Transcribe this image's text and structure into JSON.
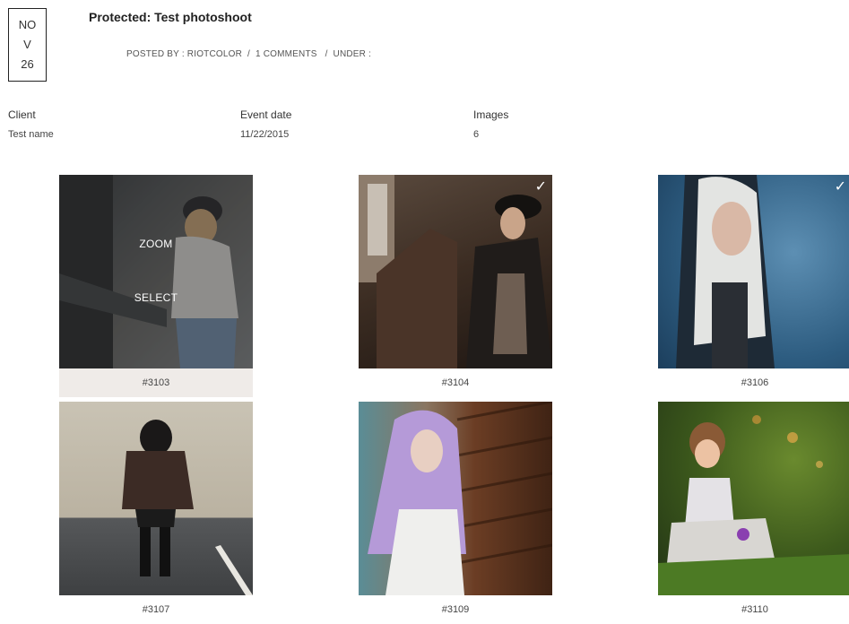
{
  "post": {
    "date_lines": [
      "NO",
      "V",
      "26"
    ],
    "title": "Protected: Test photoshoot",
    "meta": {
      "posted_by_label": "POSTED BY :",
      "author": "RIOTCOLOR",
      "sep1": "/",
      "comments": "1 COMMENTS",
      "sep2": "/",
      "under_label": "UNDER :"
    }
  },
  "info": {
    "client_label": "Client",
    "client_value": "Test name",
    "event_label": "Event date",
    "event_value": "11/22/2015",
    "images_label": "Images",
    "images_value": "6"
  },
  "gallery": {
    "zoom_label": "ZOOM",
    "select_label": "SELECT",
    "check_glyph": "✓",
    "items": [
      {
        "id": "#3103",
        "selected": false,
        "hovered": true
      },
      {
        "id": "#3104",
        "selected": true,
        "hovered": false
      },
      {
        "id": "#3106",
        "selected": true,
        "hovered": false
      },
      {
        "id": "#3107",
        "selected": false,
        "hovered": false
      },
      {
        "id": "#3109",
        "selected": false,
        "hovered": false
      },
      {
        "id": "#3110",
        "selected": false,
        "hovered": false
      }
    ]
  }
}
